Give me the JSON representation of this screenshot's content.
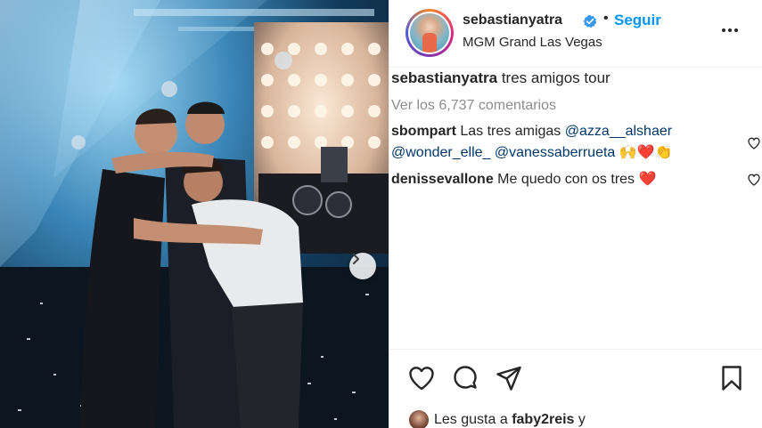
{
  "post": {
    "username": "sebastianyatra",
    "follow_label": "Seguir",
    "separator": "•",
    "location": "MGM Grand Las Vegas",
    "verified_icon": "verified-badge-icon",
    "more_icon": "more-options-icon"
  },
  "caption": {
    "username": "sebastianyatra",
    "text": "tres amigos tour"
  },
  "view_all_comments": "Ver los 6,737 comentarios",
  "comments": [
    {
      "username": "sbompart",
      "text": "Las tres amigas",
      "mentions": [
        "@azza__alshaer",
        "@wonder_elle_",
        "@vanessaberrueta"
      ],
      "emoji": "🙌❤️👏"
    },
    {
      "username": "denissevallone",
      "text": "Me quedo con os tres",
      "emoji": "❤️"
    }
  ],
  "likes": {
    "prefix": "Les gusta a",
    "username": "faby2reis",
    "suffix": "y"
  },
  "icons": {
    "like": "heart-icon",
    "comment": "comment-bubble-icon",
    "share": "paper-plane-icon",
    "save": "bookmark-icon",
    "next": "chevron-right-icon"
  },
  "colors": {
    "accent": "#0095f6",
    "mention": "#00376b",
    "muted": "#8e8e8e",
    "heart": "#ed4956"
  }
}
